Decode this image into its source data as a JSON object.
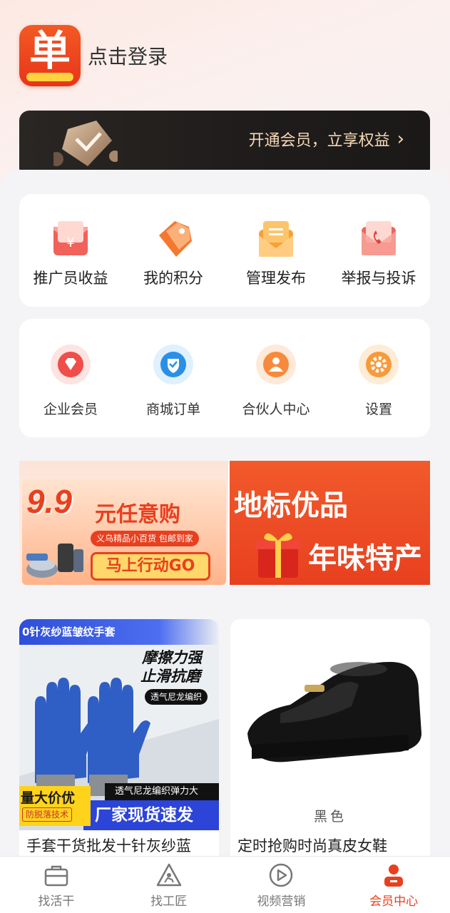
{
  "header": {
    "login_text": "点击登录",
    "logo_glyph": "单"
  },
  "vip": {
    "text": "开通会员，立享权益",
    "chevron": "›"
  },
  "quick_menu": [
    {
      "label": "推广员收益",
      "icon": "red-envelope-yuan-icon"
    },
    {
      "label": "我的积分",
      "icon": "orange-tag-icon"
    },
    {
      "label": "管理发布",
      "icon": "orange-envelope-icon"
    },
    {
      "label": "举报与投诉",
      "icon": "red-envelope-phone-icon"
    }
  ],
  "service_menu": [
    {
      "label": "企业会员",
      "icon": "red-gem-circle-icon"
    },
    {
      "label": "商城订单",
      "icon": "blue-shield-circle-icon"
    },
    {
      "label": "合伙人中心",
      "icon": "orange-person-circle-icon"
    },
    {
      "label": "设置",
      "icon": "orange-gear-circle-icon"
    }
  ],
  "banners": {
    "left": {
      "big": "9.9",
      "yuan": "元任意购",
      "sub": "义乌精品小百货 包邮到家",
      "cta": "马上行动GO"
    },
    "right": {
      "line1": "地标优品",
      "line2": "年味特产"
    }
  },
  "products": [
    {
      "title": "手套干货批发十针灰纱蓝",
      "img_top": "0针灰纱蓝皱纹手套",
      "slogan1": "摩擦力强",
      "slogan2": "止滑抗磨",
      "pill": "透气尼龙编织",
      "dark_strip": "透气尼龙编织弹力大",
      "blue_strip": "厂家现货速发",
      "yellow1": "量大价优",
      "yellow2": "防脱落技术"
    },
    {
      "title": "定时抢购时尚真皮女鞋",
      "color_label": "黑色"
    }
  ],
  "tabbar": [
    {
      "label": "找活干",
      "icon": "briefcase-icon",
      "active": false
    },
    {
      "label": "找工匠",
      "icon": "construction-worker-icon",
      "active": false
    },
    {
      "label": "视频营销",
      "icon": "play-circle-icon",
      "active": false
    },
    {
      "label": "会员中心",
      "icon": "person-icon",
      "active": true
    }
  ],
  "colors": {
    "accent": "#e8401f",
    "vip_text": "#f5d9b6",
    "vip_bg": "#1f1c1b"
  }
}
